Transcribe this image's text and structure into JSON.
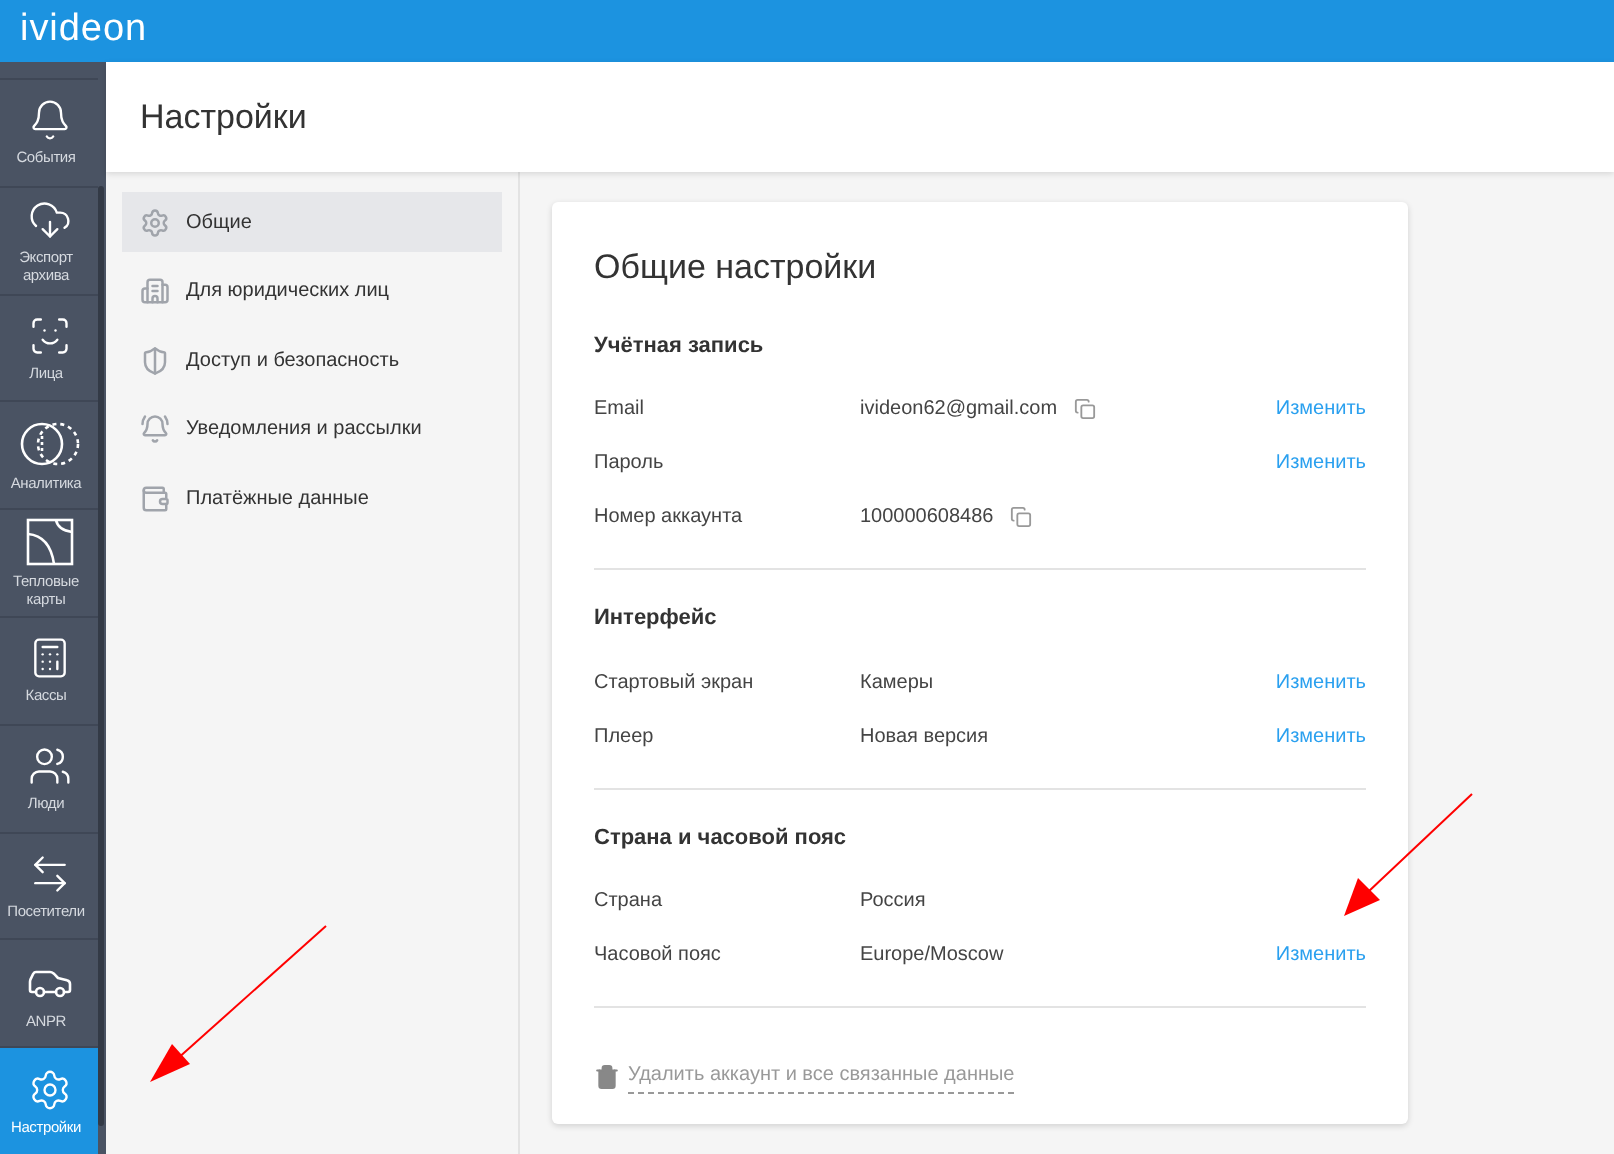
{
  "logo": "ivideon",
  "nav": [
    {
      "kind": "bell",
      "label": "События",
      "selected": false
    },
    {
      "kind": "cloud",
      "label": "Экспорт архива",
      "selected": false
    },
    {
      "kind": "face",
      "label": "Лица",
      "selected": false
    },
    {
      "kind": "analytics",
      "label": "Аналитика",
      "selected": false
    },
    {
      "kind": "heatmap",
      "label": "Тепловые карты",
      "selected": false
    },
    {
      "kind": "register",
      "label": "Кассы",
      "selected": false
    },
    {
      "kind": "people",
      "label": "Люди",
      "selected": false
    },
    {
      "kind": "visitors",
      "label": "Посетители",
      "selected": false
    },
    {
      "kind": "car",
      "label": "ANPR",
      "selected": false
    },
    {
      "kind": "settings",
      "label": "Настройки",
      "selected": true
    }
  ],
  "page_title": "Настройки",
  "submenu": [
    {
      "kind": "gear",
      "label": "Общие",
      "selected": true
    },
    {
      "kind": "building",
      "label": "Для юридических лиц",
      "selected": false
    },
    {
      "kind": "shield",
      "label": "Доступ и безопасность",
      "selected": false
    },
    {
      "kind": "bell",
      "label": "Уведомления и рассылки",
      "selected": false
    },
    {
      "kind": "wallet",
      "label": "Платёжные данные",
      "selected": false
    }
  ],
  "card": {
    "title": "Общие настройки",
    "sections": [
      {
        "title": "Учётная запись",
        "rows": [
          {
            "label": "Email",
            "value": "ivideon62@gmail.com",
            "copyable": true,
            "action": "Изменить"
          },
          {
            "label": "Пароль",
            "action": "Изменить"
          },
          {
            "label": "Номер аккаунта",
            "value": "100000608486",
            "copyable": true
          }
        ]
      },
      {
        "title": "Интерфейс",
        "rows": [
          {
            "label": "Стартовый экран",
            "value": "Камеры",
            "action": "Изменить"
          },
          {
            "label": "Плеер",
            "value": "Новая версия",
            "action": "Изменить"
          }
        ]
      },
      {
        "title": "Страна и часовой пояс",
        "rows": [
          {
            "label": "Страна",
            "value": "Россия"
          },
          {
            "label": "Часовой пояс",
            "value": "Europe/Moscow",
            "action": "Изменить"
          }
        ]
      }
    ],
    "delete_link": "Удалить аккаунт и все связанные данные"
  }
}
